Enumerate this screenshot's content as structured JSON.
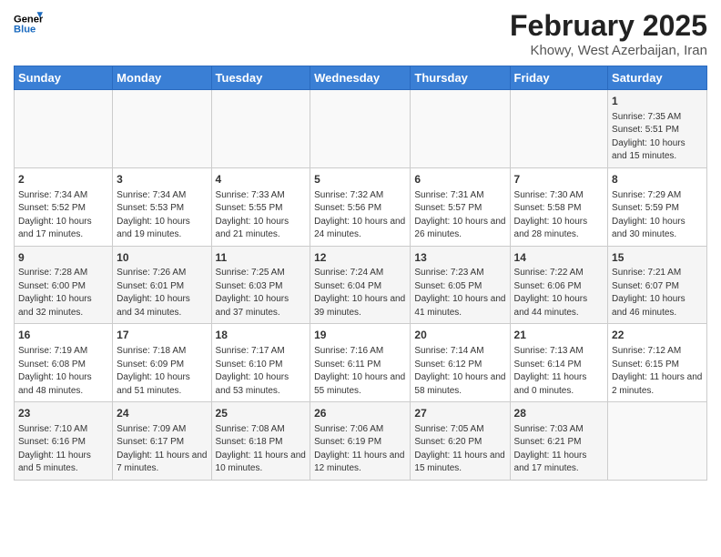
{
  "header": {
    "logo_line1": "General",
    "logo_line2": "Blue",
    "month": "February 2025",
    "location": "Khowy, West Azerbaijan, Iran"
  },
  "weekdays": [
    "Sunday",
    "Monday",
    "Tuesday",
    "Wednesday",
    "Thursday",
    "Friday",
    "Saturday"
  ],
  "weeks": [
    [
      {
        "day": "",
        "info": ""
      },
      {
        "day": "",
        "info": ""
      },
      {
        "day": "",
        "info": ""
      },
      {
        "day": "",
        "info": ""
      },
      {
        "day": "",
        "info": ""
      },
      {
        "day": "",
        "info": ""
      },
      {
        "day": "1",
        "info": "Sunrise: 7:35 AM\nSunset: 5:51 PM\nDaylight: 10 hours and 15 minutes."
      }
    ],
    [
      {
        "day": "2",
        "info": "Sunrise: 7:34 AM\nSunset: 5:52 PM\nDaylight: 10 hours and 17 minutes."
      },
      {
        "day": "3",
        "info": "Sunrise: 7:34 AM\nSunset: 5:53 PM\nDaylight: 10 hours and 19 minutes."
      },
      {
        "day": "4",
        "info": "Sunrise: 7:33 AM\nSunset: 5:55 PM\nDaylight: 10 hours and 21 minutes."
      },
      {
        "day": "5",
        "info": "Sunrise: 7:32 AM\nSunset: 5:56 PM\nDaylight: 10 hours and 24 minutes."
      },
      {
        "day": "6",
        "info": "Sunrise: 7:31 AM\nSunset: 5:57 PM\nDaylight: 10 hours and 26 minutes."
      },
      {
        "day": "7",
        "info": "Sunrise: 7:30 AM\nSunset: 5:58 PM\nDaylight: 10 hours and 28 minutes."
      },
      {
        "day": "8",
        "info": "Sunrise: 7:29 AM\nSunset: 5:59 PM\nDaylight: 10 hours and 30 minutes."
      }
    ],
    [
      {
        "day": "9",
        "info": "Sunrise: 7:28 AM\nSunset: 6:00 PM\nDaylight: 10 hours and 32 minutes."
      },
      {
        "day": "10",
        "info": "Sunrise: 7:26 AM\nSunset: 6:01 PM\nDaylight: 10 hours and 34 minutes."
      },
      {
        "day": "11",
        "info": "Sunrise: 7:25 AM\nSunset: 6:03 PM\nDaylight: 10 hours and 37 minutes."
      },
      {
        "day": "12",
        "info": "Sunrise: 7:24 AM\nSunset: 6:04 PM\nDaylight: 10 hours and 39 minutes."
      },
      {
        "day": "13",
        "info": "Sunrise: 7:23 AM\nSunset: 6:05 PM\nDaylight: 10 hours and 41 minutes."
      },
      {
        "day": "14",
        "info": "Sunrise: 7:22 AM\nSunset: 6:06 PM\nDaylight: 10 hours and 44 minutes."
      },
      {
        "day": "15",
        "info": "Sunrise: 7:21 AM\nSunset: 6:07 PM\nDaylight: 10 hours and 46 minutes."
      }
    ],
    [
      {
        "day": "16",
        "info": "Sunrise: 7:19 AM\nSunset: 6:08 PM\nDaylight: 10 hours and 48 minutes."
      },
      {
        "day": "17",
        "info": "Sunrise: 7:18 AM\nSunset: 6:09 PM\nDaylight: 10 hours and 51 minutes."
      },
      {
        "day": "18",
        "info": "Sunrise: 7:17 AM\nSunset: 6:10 PM\nDaylight: 10 hours and 53 minutes."
      },
      {
        "day": "19",
        "info": "Sunrise: 7:16 AM\nSunset: 6:11 PM\nDaylight: 10 hours and 55 minutes."
      },
      {
        "day": "20",
        "info": "Sunrise: 7:14 AM\nSunset: 6:12 PM\nDaylight: 10 hours and 58 minutes."
      },
      {
        "day": "21",
        "info": "Sunrise: 7:13 AM\nSunset: 6:14 PM\nDaylight: 11 hours and 0 minutes."
      },
      {
        "day": "22",
        "info": "Sunrise: 7:12 AM\nSunset: 6:15 PM\nDaylight: 11 hours and 2 minutes."
      }
    ],
    [
      {
        "day": "23",
        "info": "Sunrise: 7:10 AM\nSunset: 6:16 PM\nDaylight: 11 hours and 5 minutes."
      },
      {
        "day": "24",
        "info": "Sunrise: 7:09 AM\nSunset: 6:17 PM\nDaylight: 11 hours and 7 minutes."
      },
      {
        "day": "25",
        "info": "Sunrise: 7:08 AM\nSunset: 6:18 PM\nDaylight: 11 hours and 10 minutes."
      },
      {
        "day": "26",
        "info": "Sunrise: 7:06 AM\nSunset: 6:19 PM\nDaylight: 11 hours and 12 minutes."
      },
      {
        "day": "27",
        "info": "Sunrise: 7:05 AM\nSunset: 6:20 PM\nDaylight: 11 hours and 15 minutes."
      },
      {
        "day": "28",
        "info": "Sunrise: 7:03 AM\nSunset: 6:21 PM\nDaylight: 11 hours and 17 minutes."
      },
      {
        "day": "",
        "info": ""
      }
    ]
  ]
}
